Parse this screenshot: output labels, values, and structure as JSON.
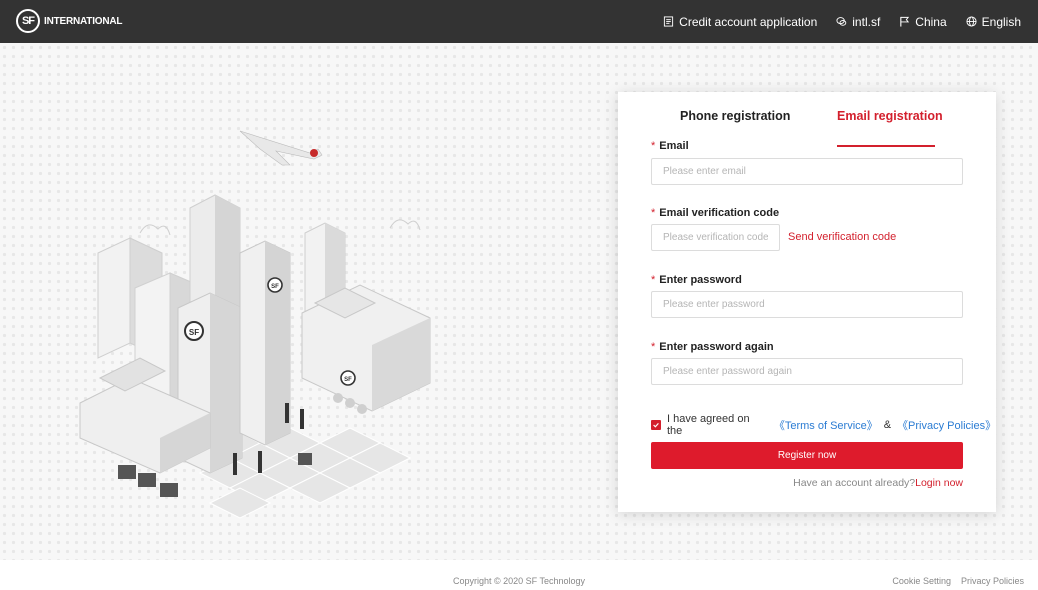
{
  "header": {
    "logo_badge": "SF",
    "logo_text": "INTERNATIONAL",
    "nav": {
      "credit": "Credit account application",
      "intl": "intl.sf",
      "country": "China",
      "language": "English"
    }
  },
  "form": {
    "tabs": {
      "phone": "Phone registration",
      "email": "Email registration",
      "active": "email"
    },
    "required_mark": "*",
    "email_label": "Email",
    "email_placeholder": "Please enter email",
    "code_label": "Email verification code",
    "code_placeholder": "Please verification code c",
    "send_code": "Send verification code",
    "password_label": "Enter password",
    "password_placeholder": "Please enter password",
    "password_again_label": "Enter password again",
    "password_again_placeholder": "Please enter password again",
    "agree_text": "I have agreed on the",
    "terms": "《Terms of Service》",
    "ampersand": "&",
    "privacy": "《Privacy Policies》",
    "agreed": true,
    "register_button": "Register now",
    "have_account": "Have an account already?",
    "login_link": "Login now"
  },
  "footer": {
    "copyright": "Copyright © 2020 SF Technology",
    "cookie": "Cookie Setting",
    "privacy": "Privacy Policies"
  },
  "colors": {
    "accent": "#de1b2c",
    "header": "#333333",
    "link": "#2b7cd3"
  }
}
